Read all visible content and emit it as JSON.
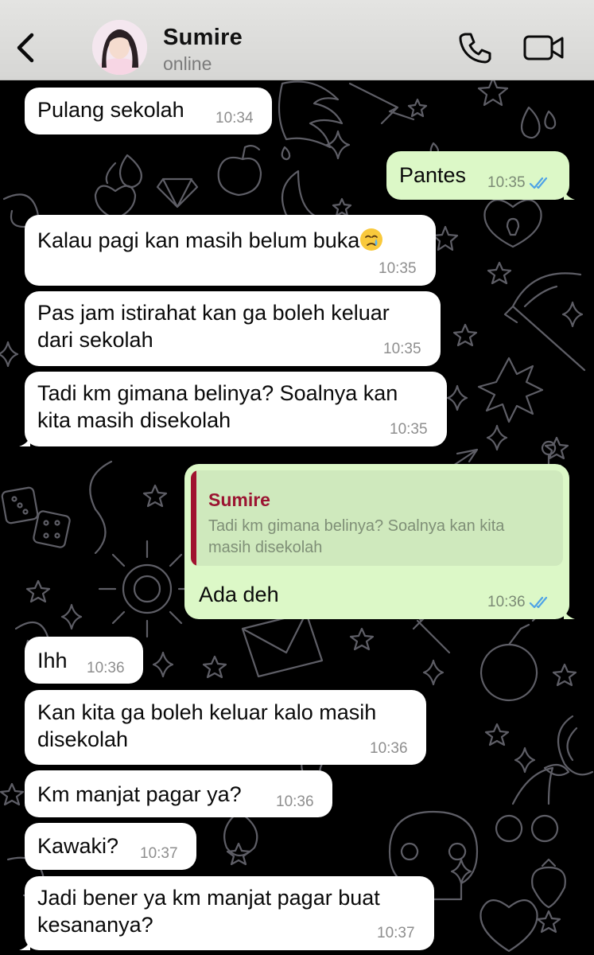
{
  "header": {
    "contact_name": "Sumire",
    "status": "online"
  },
  "colors": {
    "incoming_bubble": "#ffffff",
    "outgoing_bubble": "#dcf8c7",
    "read_ticks": "#4fa3e6",
    "reply_accent": "#9b1431"
  },
  "messages": [
    {
      "direction": "in",
      "text": "Pulang sekolah",
      "time": "10:34"
    },
    {
      "direction": "out",
      "text": "Pantes",
      "time": "10:35",
      "status": "read"
    },
    {
      "direction": "in",
      "text": "Kalau pagi kan masih belum buka",
      "emoji": "crying-face",
      "time": "10:35"
    },
    {
      "direction": "in",
      "lines": [
        "Pas jam istirahat kan ga boleh keluar",
        "dari sekolah"
      ],
      "time": "10:35"
    },
    {
      "direction": "in",
      "lines": [
        "Tadi km gimana belinya? Soalnya kan",
        "kita masih disekolah"
      ],
      "time": "10:35"
    },
    {
      "direction": "out",
      "reply": {
        "name": "Sumire",
        "lines": [
          "Tadi km gimana belinya? Soalnya kan kita",
          "masih disekolah"
        ]
      },
      "text": "Ada deh",
      "time": "10:36",
      "status": "read"
    },
    {
      "direction": "in",
      "text": "Ihh",
      "time": "10:36"
    },
    {
      "direction": "in",
      "lines": [
        "Kan kita ga boleh keluar kalo masih",
        "disekolah"
      ],
      "time": "10:36"
    },
    {
      "direction": "in",
      "text": "Km manjat pagar ya?",
      "time": "10:36"
    },
    {
      "direction": "in",
      "text": "Kawaki?",
      "time": "10:37"
    },
    {
      "direction": "in",
      "lines": [
        "Jadi bener ya km manjat pagar buat",
        "kesananya?"
      ],
      "time": "10:37"
    }
  ]
}
